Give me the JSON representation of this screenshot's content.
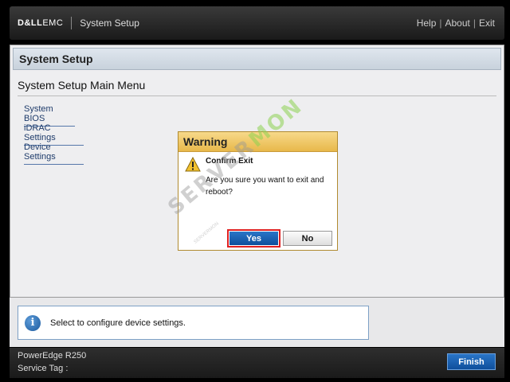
{
  "header": {
    "logo_brand": "D&LL",
    "logo_suffix": "EMC",
    "title": "System Setup",
    "links": [
      "Help",
      "About",
      "Exit"
    ]
  },
  "main": {
    "section_title": "System Setup",
    "menu_title": "System Setup Main Menu",
    "menu_items": [
      "System BIOS",
      "iDRAC Settings",
      "Device Settings"
    ]
  },
  "dialog": {
    "title": "Warning",
    "heading": "Confirm Exit",
    "message": "Are you sure you want to exit and reboot?",
    "yes_label": "Yes",
    "no_label": "No"
  },
  "info": {
    "icon": "info-icon",
    "text": "Select to configure device settings."
  },
  "footer": {
    "model": "PowerEdge R250",
    "service_tag": "Service Tag :",
    "finish_label": "Finish"
  },
  "watermark": {
    "text_left": "SERVER",
    "text_right": "MON",
    "small_text": "SERVERMON"
  },
  "colors": {
    "accent_blue": "#1f5fb0",
    "warning_header": "#e8b84a",
    "highlight_border": "#e02020"
  }
}
